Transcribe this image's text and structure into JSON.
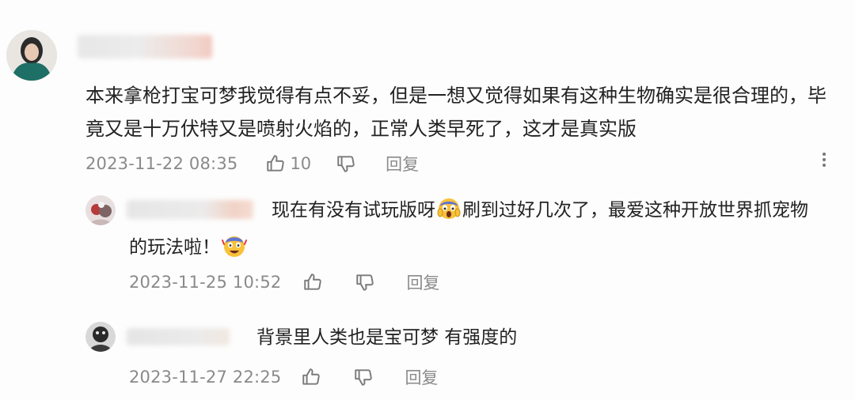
{
  "comment": {
    "text_line1": "本来拿枪打宝可梦我觉得有点不妥，但是一想又觉得如果有这种生物确实是很合理的，毕",
    "text_line2": "竟又是十万伏特又是喷射火焰的，正常人类早死了，这才是真实版",
    "timestamp": "2023-11-22 08:35",
    "like_count": "10",
    "reply_label": "回复",
    "more_icon": "more-vertical-icon"
  },
  "replies": [
    {
      "text_line1_a": "现在有没有试玩版呀",
      "text_line1_b": "刷到过好几次了，最爱这种开放世界抓宠物",
      "text_line2": "的玩法啦！",
      "timestamp": "2023-11-25 10:52",
      "reply_label": "回复"
    },
    {
      "text_line1": "背景里人类也是宝可梦 有强度的",
      "timestamp": "2023-11-27 22:25",
      "reply_label": "回复"
    }
  ],
  "colors": {
    "meta": "#8a8a8a",
    "text": "#222222",
    "background": "#fdfdfd"
  }
}
